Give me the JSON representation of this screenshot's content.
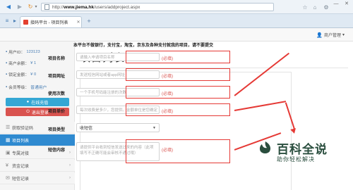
{
  "browser": {
    "url_prefix": "http://",
    "url_host": "www.jiema.hk",
    "url_path": "/users/addproject.aspx",
    "tab_label": "接码平台 - 项目列表",
    "icons": {
      "back": "back-arrow-icon",
      "forward": "forward-arrow-icon",
      "refresh": "refresh-icon",
      "star": "star-icon",
      "home": "home-icon",
      "settings": "gear-icon",
      "new_tab": "plus-icon"
    }
  },
  "header": {
    "user_menu_label": "商户管理",
    "user_menu_caret": "▾"
  },
  "sidebar": {
    "user_id_label": "用户ID：",
    "user_id": "123123",
    "available_balance_label": "商户余额：",
    "available_balance": "¥ 1",
    "frozen_balance_label": "锁定金额：",
    "frozen_balance": "¥ 0",
    "member_level_label": "会员等级：",
    "member_level": "普通用户",
    "online_button": "在线充值",
    "logout_button": "退出登录",
    "menu": [
      {
        "label": "获取验证码",
        "icon": "list-icon",
        "active": false,
        "caret": false
      },
      {
        "label": "项目列表",
        "icon": "grid-icon",
        "active": true,
        "caret": false
      },
      {
        "label": "专属对接",
        "icon": "bookmark-icon",
        "active": false,
        "caret": true
      },
      {
        "label": "资金记录",
        "icon": "money-icon",
        "active": false,
        "caret": true
      },
      {
        "label": "短信记录",
        "icon": "message-icon",
        "active": false,
        "caret": true
      }
    ]
  },
  "main": {
    "title": "项目列表",
    "notice": "本平台不做银行，支付宝，淘宝，京东及各种支付就我的项目，请不要提交",
    "fields": [
      {
        "label": "项目名称",
        "placeholder": "请输入申请项目名称",
        "required": "(必填)"
      },
      {
        "label": "项目网址",
        "placeholder": "发送短信网站或者app网址",
        "required": "(必填)"
      },
      {
        "label": "使用次数",
        "placeholder": "一个手机号码能注册的次数",
        "required": "(必填)"
      },
      {
        "label": "项目单价",
        "placeholder": "每次收费是多少，您提供。金额单位是您确定",
        "required": "(必填)"
      }
    ],
    "type_label": "项目类型",
    "type_value": "收短信",
    "content_label": "短信内容",
    "content_placeholder": "请提供平台收到短信发送过来的内容（此项填写不正确可能会审核不通过哦）",
    "content_required": "(必填)"
  },
  "annotation_color": "#e53935",
  "watermark": {
    "title": "百科全说",
    "subtitle": "助你轻松解决"
  }
}
